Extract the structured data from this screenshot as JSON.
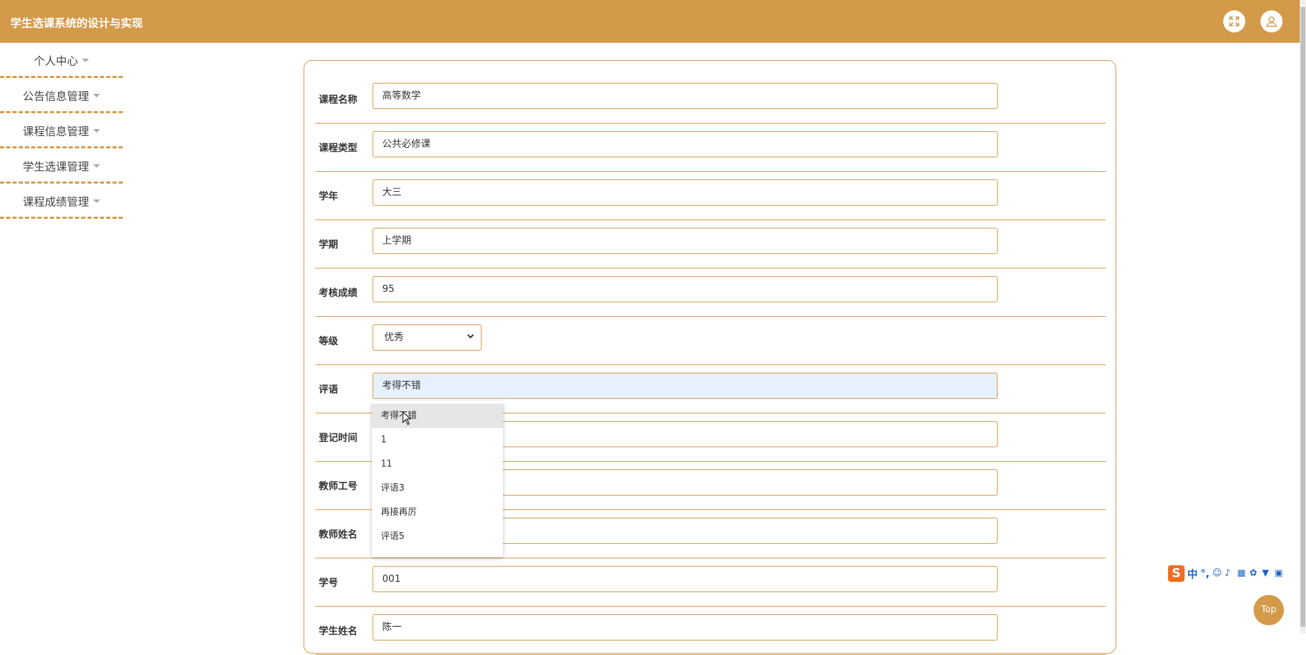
{
  "header": {
    "title": "学生选课系统的设计与实现"
  },
  "sidebar": {
    "items": [
      {
        "label": "个人中心"
      },
      {
        "label": "公告信息管理"
      },
      {
        "label": "课程信息管理"
      },
      {
        "label": "学生选课管理"
      },
      {
        "label": "课程成绩管理"
      }
    ]
  },
  "form": {
    "fields": [
      {
        "label": "课程名称",
        "value": "高等数学"
      },
      {
        "label": "课程类型",
        "value": "公共必修课"
      },
      {
        "label": "学年",
        "value": "大三"
      },
      {
        "label": "学期",
        "value": "上学期"
      },
      {
        "label": "考核成绩",
        "value": "95"
      },
      {
        "label": "等级",
        "value": "优秀"
      },
      {
        "label": "评语",
        "value": "考得不错"
      },
      {
        "label": "登记时间",
        "value": ""
      },
      {
        "label": "教师工号",
        "value": ""
      },
      {
        "label": "教师姓名",
        "value": ""
      },
      {
        "label": "学号",
        "value": "001"
      },
      {
        "label": "学生姓名",
        "value": "陈一"
      }
    ]
  },
  "autocomplete": {
    "options": [
      "考得不错",
      "1",
      "11",
      "评语3",
      "再接再厉",
      "评语5"
    ]
  },
  "ime": {
    "lang": "中",
    "punct": "°,"
  },
  "top_button": {
    "label": "Top"
  },
  "colors": {
    "accent": "#d39a4a",
    "focus_bg": "#e7f0fd"
  }
}
